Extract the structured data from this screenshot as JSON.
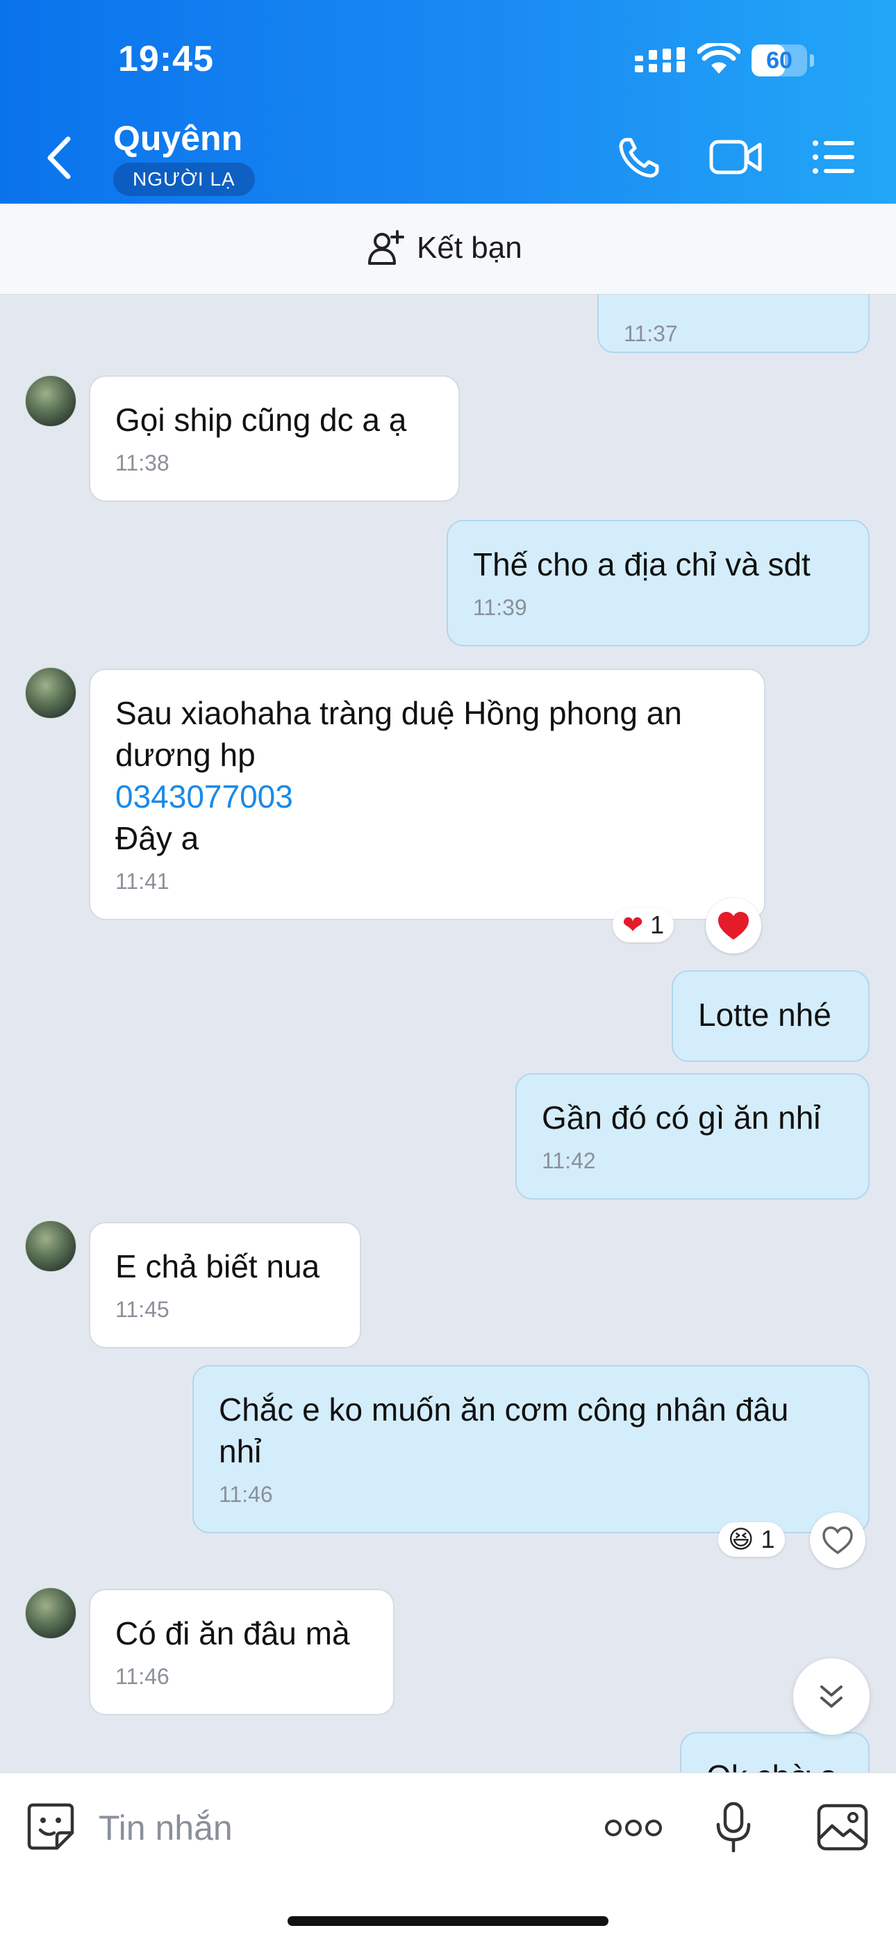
{
  "status_bar": {
    "time": "19:45",
    "battery": "60",
    "battery_level": 0.6
  },
  "header": {
    "contact_name": "Quyênn",
    "badge": "NGƯỜI LẠ"
  },
  "friend_bar": {
    "label": "Kết bạn"
  },
  "messages": [
    {
      "dir": "out",
      "text": "",
      "time": "11:37"
    },
    {
      "dir": "in",
      "text": "Gọi ship cũng dc a ạ",
      "time": "11:38"
    },
    {
      "dir": "out",
      "text": "Thế cho a địa chỉ và sdt",
      "time": "11:39"
    },
    {
      "dir": "in",
      "text": "Sau xiaohaha tràng duệ Hồng phong an\ndương hp",
      "link": "0343077003",
      "text2": "Đây a",
      "time": "11:41",
      "reaction": {
        "emoji": "❤",
        "count": "1"
      }
    },
    {
      "dir": "out",
      "text": "Lotte nhé",
      "time": ""
    },
    {
      "dir": "out",
      "text": "Gần đó có gì ăn nhỉ",
      "time": "11:42"
    },
    {
      "dir": "in",
      "text": "E chả biết nua",
      "time": "11:45"
    },
    {
      "dir": "out",
      "text": "Chắc e ko muốn ăn cơm công nhân đâu\nnhỉ",
      "time": "11:46",
      "reaction": {
        "emoji": "😆",
        "count": "1"
      }
    },
    {
      "dir": "in",
      "text": "Có đi ăn đâu mà",
      "time": "11:46"
    },
    {
      "dir": "out",
      "text": "Ok chờ a",
      "time": ""
    }
  ],
  "composer": {
    "placeholder": "Tin nhắn"
  },
  "colors": {
    "header_start": "#0a73ec",
    "header_end": "#22a6f7",
    "chat_bg": "#e3e8f0",
    "out_bubble": "#d4edfa",
    "link": "#1a8ae8"
  },
  "icons": [
    "back-icon",
    "phone-icon",
    "video-camera-icon",
    "list-menu-icon",
    "add-friend-icon",
    "heart-icon",
    "chevron-double-down-icon",
    "sticker-icon",
    "more-dots-icon",
    "microphone-icon",
    "image-icon"
  ]
}
